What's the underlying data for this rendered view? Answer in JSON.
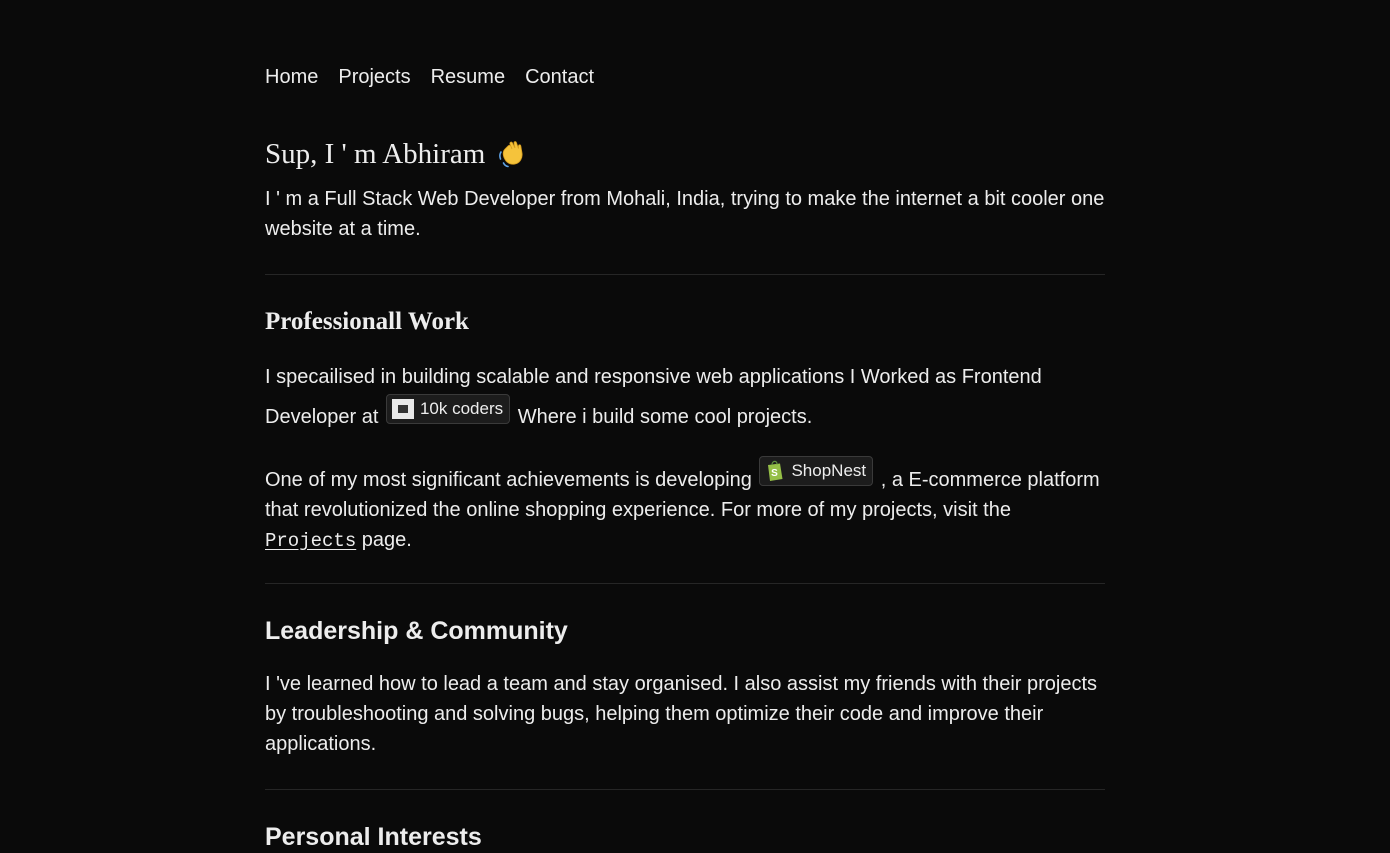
{
  "nav": {
    "items": [
      "Home",
      "Projects",
      "Resume",
      "Contact"
    ]
  },
  "hero": {
    "title": "Sup, I ' m Abhiram",
    "wave_icon": "waving-hand-icon",
    "intro": "I ' m a Full Stack Web Developer from Mohali, India, trying to make the internet a bit cooler one website at a time."
  },
  "professional": {
    "title": "Professionall Work",
    "p1_before": "I specailised in building scalable and responsive web applications I Worked as Frontend Developer at",
    "p1_chip": "10k coders",
    "p1_after": "Where i build some cool projects.",
    "p2_before": "One of my most significant achievements is developing",
    "p2_chip": "ShopNest",
    "p2_after": ", a E-commerce platform that revolutionized the online shopping experience. For more of my projects, visit the",
    "p2_link": "Projects",
    "p2_end": "page."
  },
  "leadership": {
    "title": "Leadership & Community",
    "text": "I 've learned how to lead a team and stay organised. I also assist my friends with their projects by troubleshooting and solving bugs, helping them optimize their code and improve their applications."
  },
  "interests": {
    "title": "Personal Interests"
  },
  "colors": {
    "background": "#0a0a0a",
    "text": "#ededed",
    "divider": "#262626",
    "shopify_green": "#95bf47"
  }
}
